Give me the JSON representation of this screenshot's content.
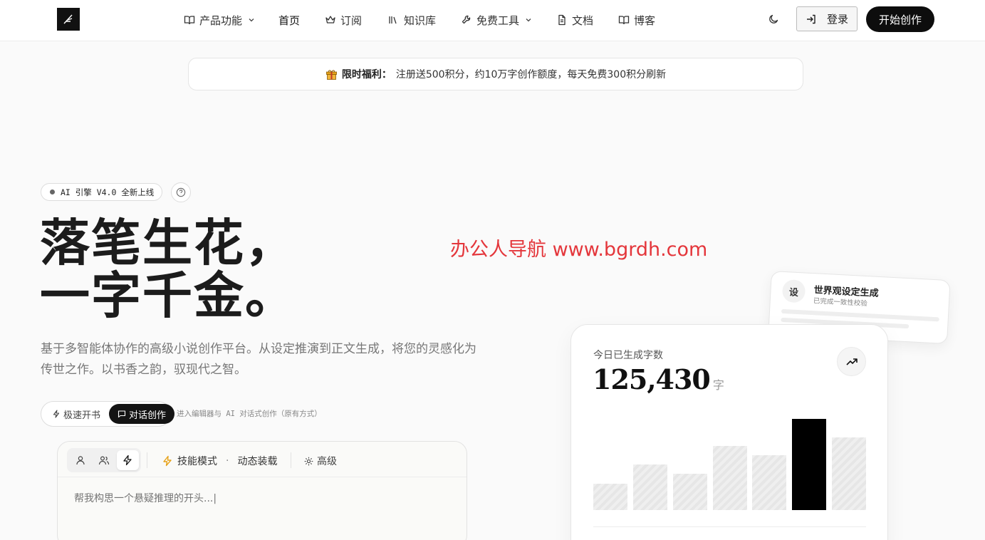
{
  "header": {
    "nav": [
      {
        "label": "产品功能",
        "icon": "book-open-icon",
        "dropdown": true
      },
      {
        "label": "首页",
        "icon": "",
        "dropdown": false
      },
      {
        "label": "订阅",
        "icon": "crown-icon",
        "dropdown": false
      },
      {
        "label": "知识库",
        "icon": "library-icon",
        "dropdown": false
      },
      {
        "label": "免费工具",
        "icon": "wrench-icon",
        "dropdown": true
      },
      {
        "label": "文档",
        "icon": "file-text-icon",
        "dropdown": false
      },
      {
        "label": "博客",
        "icon": "book-open-icon",
        "dropdown": false
      }
    ],
    "login_label": "登录",
    "start_label": "开始创作"
  },
  "promo": {
    "lead": "限时福利：",
    "text": "注册送500积分，约10万字创作额度，每天免费300积分刷新"
  },
  "hero": {
    "badge": "AI 引擎 V4.0 全新上线",
    "title_line1": "落笔生花，",
    "title_line2": "一字千金。",
    "description": "基于多智能体协作的高级小说创作平台。从设定推演到正文生成，将您的灵感化为传世之作。以书香之韵，驭现代之智。",
    "modes": [
      "极速开书",
      "对话创作"
    ],
    "active_mode": "对话创作",
    "mode_hint": "进入编辑器与 AI 对话式创作（原有方式）"
  },
  "composer": {
    "skill_mode": "技能模式",
    "dynamic": "动态装载",
    "advanced": "高级",
    "placeholder": "帮我构思一个悬疑推理的开头...|"
  },
  "watermark": "办公人导航  www.bgrdh.com",
  "float_card": {
    "icon_char": "设",
    "title": "世界观设定生成",
    "subtitle": "已完成一致性校验"
  },
  "stats": {
    "label": "今日已生成字数",
    "value": "125,430",
    "unit": "字",
    "bar_levels": [
      0.29,
      0.5,
      0.4,
      0.7,
      0.6,
      1.0,
      0.8
    ],
    "highlight_index": 5
  },
  "colors": {
    "accent": "#0d0d0d",
    "watermark": "#e4363b",
    "gift": "#e6a21a",
    "bolt": "#e6a21a"
  }
}
